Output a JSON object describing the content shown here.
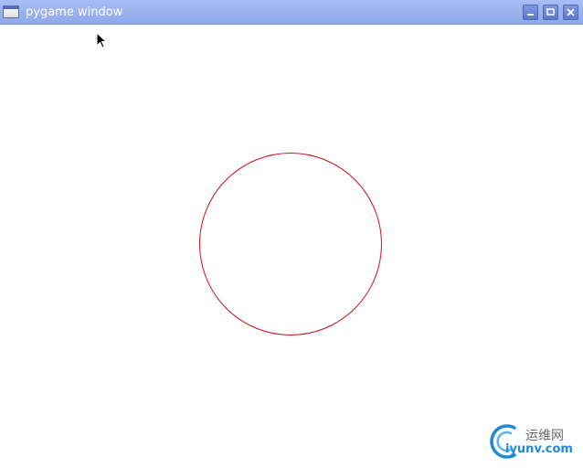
{
  "window": {
    "title": "pygame window",
    "icon": "window-app-icon",
    "controls": {
      "minimize": "minimize-icon",
      "maximize": "maximize-icon",
      "close": "close-icon"
    },
    "titlebar_color": "#9db4f0"
  },
  "canvas": {
    "background": "#ffffff",
    "shape": {
      "type": "circle",
      "stroke_color": "#c8101e",
      "fill": "none"
    }
  },
  "cursor": {
    "icon": "arrow-cursor-icon"
  },
  "watermark": {
    "text_cn": "运维网",
    "text_url": "iyunv.com",
    "accent": "#1f8ad6"
  }
}
